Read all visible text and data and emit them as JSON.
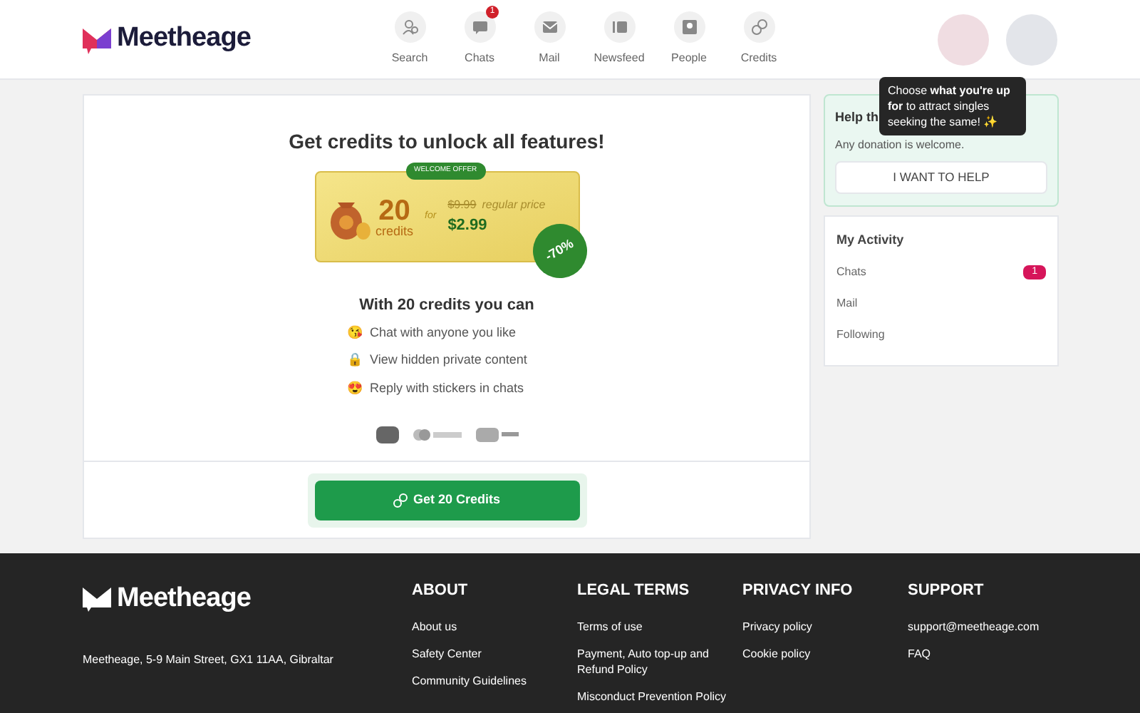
{
  "header": {
    "logo": "Meetheage",
    "nav": [
      {
        "label": "Search"
      },
      {
        "label": "Chats",
        "badge": "1"
      },
      {
        "label": "Mail"
      },
      {
        "label": "Newsfeed"
      },
      {
        "label": "People"
      },
      {
        "label": "Credits"
      }
    ]
  },
  "tooltip": {
    "text": "Choose **what you're up for** to attract singles seeking the same!",
    "icon": "✨"
  },
  "offer": {
    "title": "Get credits to unlock all features!",
    "ribbon": "WELCOME OFFER",
    "amount": "20",
    "unit": "credits",
    "for": "for",
    "old_price": "$9.99",
    "regular": "regular price",
    "price": "$2.99",
    "discount": "-70%",
    "benefits_title": "With 20 credits you can",
    "benefits": [
      {
        "icon": "😘",
        "text": "Chat with anyone you like"
      },
      {
        "icon": "🔒",
        "text": "View hidden private content"
      },
      {
        "icon": "😍",
        "text": "Reply with stickers in chats"
      }
    ],
    "button": "Get 20 Credits"
  },
  "help": {
    "title": "Help th",
    "text": "Any donation is welcome.",
    "button": "I WANT TO HELP"
  },
  "activity": {
    "title": "My Activity",
    "items": [
      {
        "label": "Chats",
        "count": "1"
      },
      {
        "label": "Mail"
      },
      {
        "label": "Following"
      }
    ]
  },
  "footer": {
    "logo": "Meetheage",
    "address": "Meetheage, 5-9 Main Street, GX1 11AA, Gibraltar",
    "columns": [
      {
        "title": "ABOUT",
        "links": [
          "About us",
          "Safety Center",
          "Community Guidelines"
        ]
      },
      {
        "title": "LEGAL TERMS",
        "links": [
          "Terms of use",
          "Payment, Auto top-up and Refund Policy",
          "Misconduct Prevention Policy"
        ]
      },
      {
        "title": "PRIVACY INFO",
        "links": [
          "Privacy policy",
          "Cookie policy"
        ]
      },
      {
        "title": "SUPPORT",
        "links": [
          "support@meetheage.com",
          "FAQ"
        ]
      }
    ]
  }
}
